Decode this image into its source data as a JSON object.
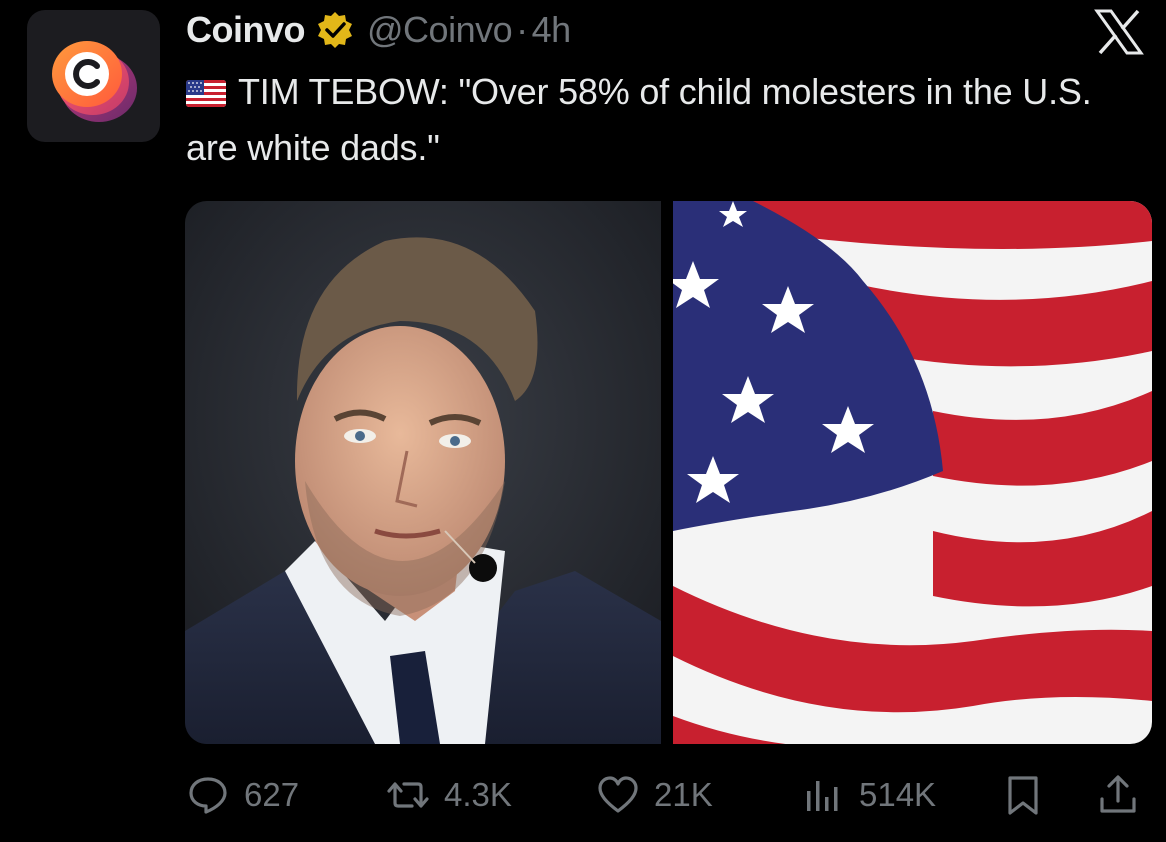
{
  "tweet": {
    "display_name": "Coinvo",
    "handle": "@Coinvo",
    "separator": "·",
    "time": "4h",
    "text": "TIM TEBOW: \"Over 58% of child molesters in the U.S. are white dads.\"",
    "flag_icon": "us-flag-emoji"
  },
  "actions": {
    "replies": "627",
    "reposts": "4.3K",
    "likes": "21K",
    "views": "514K"
  },
  "colors": {
    "background": "#000000",
    "text": "#e7e9ea",
    "muted": "#71767b",
    "verified_gold": "#e2b719"
  },
  "icons": [
    "coinvo-avatar-icon",
    "verified-badge-icon",
    "x-logo-icon",
    "reply-icon",
    "repost-icon",
    "like-icon",
    "views-icon",
    "bookmark-icon",
    "share-icon"
  ]
}
